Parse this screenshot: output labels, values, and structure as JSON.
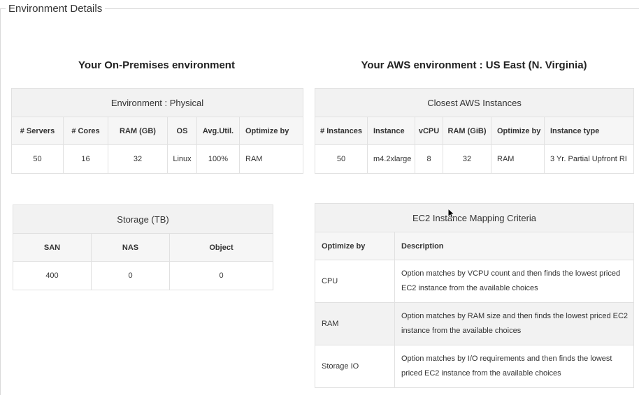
{
  "panel": {
    "legend": "Environment Details"
  },
  "onprem": {
    "title": "Your On-Premises environment",
    "env_caption": "Environment : Physical",
    "headers": [
      "# Servers",
      "# Cores",
      "RAM (GB)",
      "OS",
      "Avg.Util.",
      "Optimize by"
    ],
    "row": [
      "50",
      "16",
      "32",
      "Linux",
      "100%",
      "RAM"
    ]
  },
  "storage": {
    "caption": "Storage (TB)",
    "headers": [
      "SAN",
      "NAS",
      "Object"
    ],
    "row": [
      "400",
      "0",
      "0"
    ]
  },
  "aws": {
    "title": "Your AWS environment : US East (N. Virginia)",
    "instances_caption": "Closest AWS Instances",
    "headers": [
      "# Instances",
      "Instance",
      "vCPU",
      "RAM (GiB)",
      "Optimize by",
      "Instance type"
    ],
    "row": [
      "50",
      "m4.2xlarge",
      "8",
      "32",
      "RAM",
      "3 Yr. Partial Upfront RI"
    ]
  },
  "criteria": {
    "caption": "EC2 Instance Mapping Criteria",
    "headers": [
      "Optimize by",
      "Description"
    ],
    "rows": [
      {
        "optimize": "CPU",
        "description": "Option matches by VCPU count and then finds the lowest priced EC2 instance from the available choices"
      },
      {
        "optimize": "RAM",
        "description": "Option matches by RAM size and then finds the lowest priced EC2 instance from the available choices"
      },
      {
        "optimize": "Storage IO",
        "description": "Option matches by I/O requirements and then finds the lowest priced EC2 instance from the available choices"
      }
    ]
  }
}
